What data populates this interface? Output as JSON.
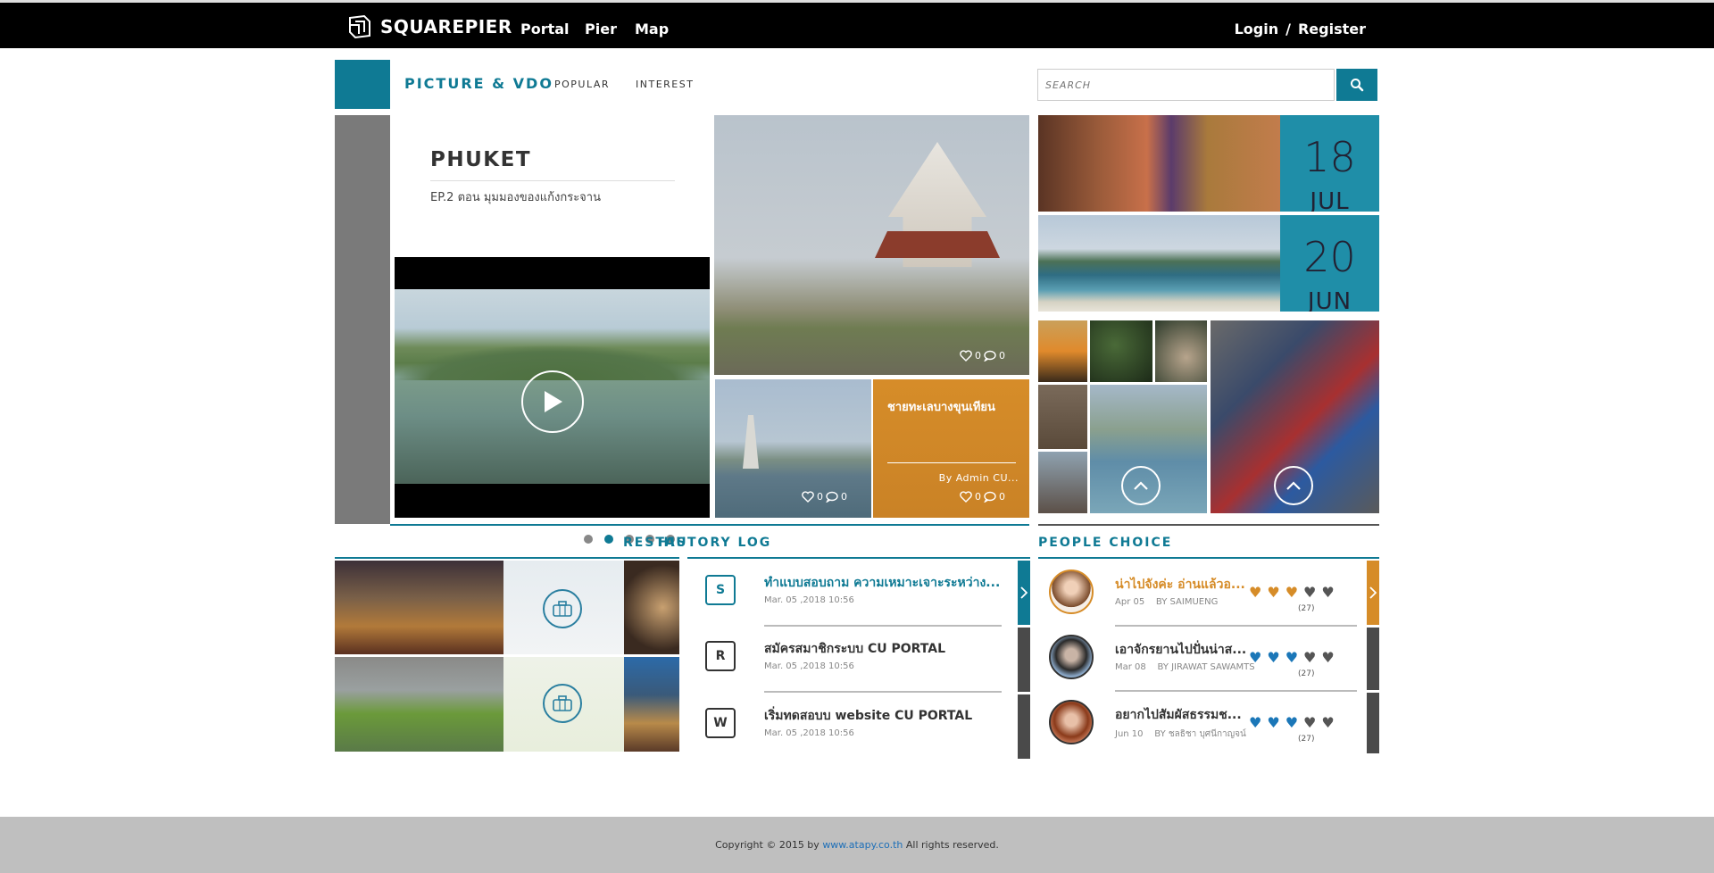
{
  "brand": {
    "name": "SQUAREPIER"
  },
  "nav": {
    "portal": "Portal",
    "pier": "Pier",
    "map": "Map"
  },
  "auth": {
    "login": "Login",
    "separator": "/",
    "register": "Register"
  },
  "section": {
    "title": "PICTURE & VDO",
    "tabs": [
      "POPULAR",
      "INTEREST"
    ]
  },
  "search": {
    "placeholder": "SEARCH"
  },
  "feature": {
    "title": "PHUKET",
    "subtitle": "EP.2 ตอน มุมมองของแก้งกระจาน"
  },
  "tiles": {
    "temple": {
      "likes": "0",
      "comments": "0"
    },
    "pagoda": {
      "likes": "0",
      "comments": "0"
    },
    "orange": {
      "title": "ชายทะเลบางขุนเทียน",
      "by": "By Admin CU...",
      "likes": "0",
      "comments": "0"
    }
  },
  "events": [
    {
      "day": "18",
      "month": "JUL"
    },
    {
      "day": "20",
      "month": "JUN"
    }
  ],
  "carousel": {
    "count": 5,
    "active": 1
  },
  "restau": {
    "heading": "RESTAU"
  },
  "history": {
    "heading": "HISTORY LOG",
    "items": [
      {
        "badge": "S",
        "title": "ทำแบบสอบถาม ความเหมาะเจาะระหว่าง...",
        "date": "Mar. 05 ,2018 10:56"
      },
      {
        "badge": "R",
        "title": "สมัครสมาชิกระบบ CU PORTAL",
        "date": "Mar. 05 ,2018 10:56"
      },
      {
        "badge": "W",
        "title": "เริ่มทดสอบบ website CU PORTAL",
        "date": "Mar. 05 ,2018 10:56"
      }
    ]
  },
  "people": {
    "heading": "PEOPLE CHOICE",
    "items": [
      {
        "title": "น่าไปจังค่ะ อ่านแล้วอ...",
        "date": "Apr 05",
        "by": "BY SAIMUENG",
        "rating": 3,
        "count": "(27)"
      },
      {
        "title": "เอาจักรยานไปปั่นน่าส...",
        "date": "Mar 08",
        "by": "BY JIRAWAT SAWAMTS",
        "rating": 3,
        "count": "(27)"
      },
      {
        "title": "อยากไปสัมผัสธรรมช...",
        "date": "Jun 10",
        "by": "BY ชลธิชา บุศนีกาญจน์",
        "rating": 3,
        "count": "(27)"
      }
    ]
  },
  "footer": {
    "prefix": "Copyright © 2015 by",
    "link": "www.atapy.co.th",
    "suffix": "All rights reserved."
  },
  "colors": {
    "teal": "#0f7a94",
    "orange": "#d68c28",
    "heart_blue": "#1b77b8",
    "heart_gray": "#555555"
  }
}
